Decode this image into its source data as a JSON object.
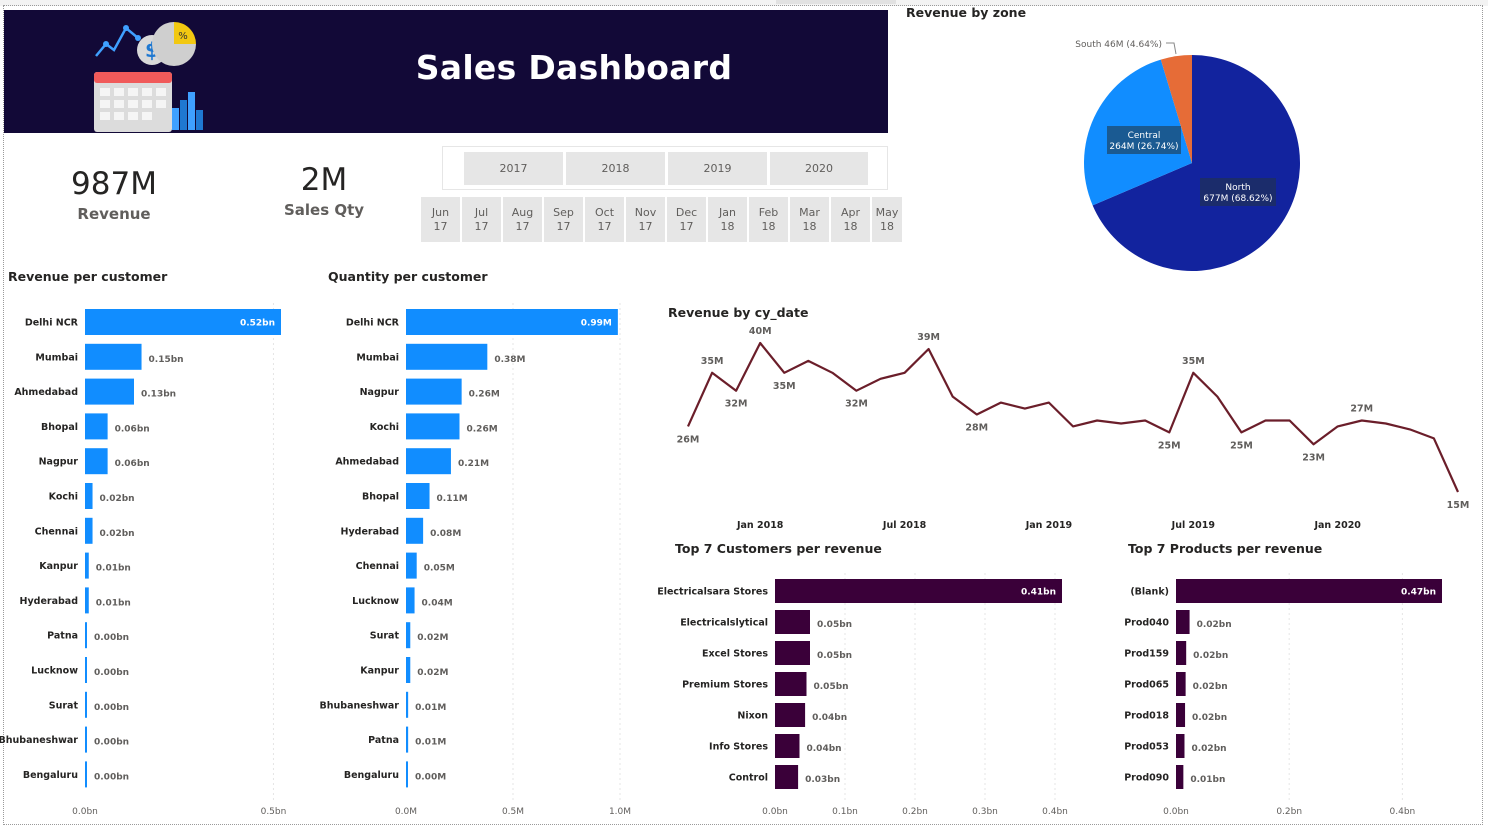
{
  "header": {
    "title": "Sales Dashboard"
  },
  "kpis": [
    {
      "value": "987M",
      "label": "Revenue"
    },
    {
      "value": "2M",
      "label": "Sales Qty"
    }
  ],
  "slicer": {
    "years": [
      "2017",
      "2018",
      "2019",
      "2020"
    ],
    "months": [
      {
        "m": "Jun",
        "y": "17"
      },
      {
        "m": "Jul",
        "y": "17"
      },
      {
        "m": "Aug",
        "y": "17"
      },
      {
        "m": "Sep",
        "y": "17"
      },
      {
        "m": "Oct",
        "y": "17"
      },
      {
        "m": "Nov",
        "y": "17"
      },
      {
        "m": "Dec",
        "y": "17"
      },
      {
        "m": "Jan",
        "y": "18"
      },
      {
        "m": "Feb",
        "y": "18"
      },
      {
        "m": "Mar",
        "y": "18"
      },
      {
        "m": "Apr",
        "y": "18"
      },
      {
        "m": "May",
        "y": "18"
      }
    ]
  },
  "colors": {
    "banner": "#120937",
    "bar_blue": "#118dff",
    "bar_purple": "#3a0039",
    "line": "#6b1e2a",
    "pie_north": "#12239e",
    "pie_central": "#118dff",
    "pie_south": "#e66c37"
  },
  "chart_data": [
    {
      "id": "revenue_per_customer",
      "type": "bar",
      "title": "Revenue per customer",
      "categories": [
        "Delhi NCR",
        "Mumbai",
        "Ahmedabad",
        "Bhopal",
        "Nagpur",
        "Kochi",
        "Chennai",
        "Kanpur",
        "Hyderabad",
        "Patna",
        "Lucknow",
        "Surat",
        "Bhubaneshwar",
        "Bengaluru"
      ],
      "values": [
        0.52,
        0.15,
        0.13,
        0.06,
        0.06,
        0.02,
        0.02,
        0.01,
        0.01,
        0.004,
        0.003,
        0.002,
        0.001,
        0.001
      ],
      "labels": [
        "0.52bn",
        "0.15bn",
        "0.13bn",
        "0.06bn",
        "0.06bn",
        "0.02bn",
        "0.02bn",
        "0.01bn",
        "0.01bn",
        "0.00bn",
        "0.00bn",
        "0.00bn",
        "0.00bn",
        "0.00bn"
      ],
      "xlim": [
        0,
        0.52
      ],
      "ticks": [
        0,
        0.5
      ],
      "tick_labels": [
        "0.0bn",
        "0.5bn"
      ]
    },
    {
      "id": "quantity_per_customer",
      "type": "bar",
      "title": "Quantity per customer",
      "categories": [
        "Delhi NCR",
        "Mumbai",
        "Nagpur",
        "Kochi",
        "Ahmedabad",
        "Bhopal",
        "Hyderabad",
        "Chennai",
        "Lucknow",
        "Surat",
        "Kanpur",
        "Bhubaneshwar",
        "Patna",
        "Bengaluru"
      ],
      "values": [
        0.99,
        0.38,
        0.26,
        0.25,
        0.21,
        0.11,
        0.08,
        0.05,
        0.04,
        0.02,
        0.02,
        0.01,
        0.01,
        0.003
      ],
      "labels": [
        "0.99M",
        "0.38M",
        "0.26M",
        "0.26M",
        "0.21M",
        "0.11M",
        "0.08M",
        "0.05M",
        "0.04M",
        "0.02M",
        "0.02M",
        "0.01M",
        "0.01M",
        "0.00M"
      ],
      "xlim": [
        0,
        1.0
      ],
      "ticks": [
        0,
        0.5,
        1.0
      ],
      "tick_labels": [
        "0.0M",
        "0.5M",
        "1.0M"
      ]
    },
    {
      "id": "revenue_by_zone",
      "type": "pie",
      "title": "Revenue by zone",
      "slices": [
        {
          "name": "North",
          "value": 677,
          "label_line1": "North",
          "label_line2": "677M (68.62%)"
        },
        {
          "name": "Central",
          "value": 264,
          "label_line1": "Central",
          "label_line2": "264M (26.74%)"
        },
        {
          "name": "South",
          "value": 46,
          "label_line1": "South 46M (4.64%)"
        }
      ]
    },
    {
      "id": "revenue_by_cy_date",
      "type": "line",
      "title": "Revenue by cy_date",
      "x": [
        "2017-10",
        "2017-11",
        "2017-12",
        "2018-01",
        "2018-02",
        "2018-03",
        "2018-04",
        "2018-05",
        "2018-06",
        "2018-07",
        "2018-08",
        "2018-09",
        "2018-10",
        "2018-11",
        "2018-12",
        "2019-01",
        "2019-02",
        "2019-03",
        "2019-04",
        "2019-05",
        "2019-06",
        "2019-07",
        "2019-08",
        "2019-09",
        "2019-10",
        "2019-11",
        "2019-12",
        "2020-01",
        "2020-02",
        "2020-03",
        "2020-04",
        "2020-05",
        "2020-06"
      ],
      "values": [
        26,
        35,
        32,
        40,
        35,
        37,
        35,
        32,
        34,
        35,
        39,
        31,
        28,
        30,
        29,
        30,
        26,
        27,
        26.5,
        27,
        25,
        35,
        31,
        25,
        27,
        27,
        23,
        26,
        27,
        26.5,
        25.5,
        24,
        15
      ],
      "point_labels": [
        {
          "i": 0,
          "text": "26M"
        },
        {
          "i": 1,
          "text": "35M"
        },
        {
          "i": 2,
          "text": "32M"
        },
        {
          "i": 3,
          "text": "40M"
        },
        {
          "i": 4,
          "text": "35M"
        },
        {
          "i": 7,
          "text": "32M"
        },
        {
          "i": 10,
          "text": "39M"
        },
        {
          "i": 12,
          "text": "28M"
        },
        {
          "i": 20,
          "text": "25M"
        },
        {
          "i": 21,
          "text": "35M"
        },
        {
          "i": 23,
          "text": "25M"
        },
        {
          "i": 26,
          "text": "23M"
        },
        {
          "i": 28,
          "text": "27M"
        },
        {
          "i": 32,
          "text": "15M"
        }
      ],
      "x_ticks": [
        {
          "i": 3,
          "text": "Jan 2018"
        },
        {
          "i": 9,
          "text": "Jul 2018"
        },
        {
          "i": 15,
          "text": "Jan 2019"
        },
        {
          "i": 21,
          "text": "Jul 2019"
        },
        {
          "i": 27,
          "text": "Jan 2020"
        }
      ],
      "ylim": [
        15,
        40
      ]
    },
    {
      "id": "top7_customers",
      "type": "bar",
      "title": "Top 7 Customers per revenue",
      "categories": [
        "Electricalsara Stores",
        "Electricalslytical",
        "Excel Stores",
        "Premium Stores",
        "Nixon",
        "Info Stores",
        "Control"
      ],
      "values": [
        0.41,
        0.05,
        0.05,
        0.045,
        0.043,
        0.035,
        0.033
      ],
      "labels": [
        "0.41bn",
        "0.05bn",
        "0.05bn",
        "0.05bn",
        "0.04bn",
        "0.04bn",
        "0.03bn"
      ],
      "xlim": [
        0,
        0.41
      ],
      "ticks": [
        0,
        0.1,
        0.2,
        0.3,
        0.4
      ],
      "tick_labels": [
        "0.0bn",
        "0.1bn",
        "0.2bn",
        "0.3bn",
        "0.4bn"
      ]
    },
    {
      "id": "top7_products",
      "type": "bar",
      "title": "Top 7 Products per revenue",
      "categories": [
        "(Blank)",
        "Prod040",
        "Prod159",
        "Prod065",
        "Prod018",
        "Prod053",
        "Prod090"
      ],
      "values": [
        0.47,
        0.024,
        0.018,
        0.017,
        0.016,
        0.015,
        0.013
      ],
      "labels": [
        "0.47bn",
        "0.02bn",
        "0.02bn",
        "0.02bn",
        "0.02bn",
        "0.02bn",
        "0.01bn"
      ],
      "xlim": [
        0,
        0.47
      ],
      "ticks": [
        0,
        0.2,
        0.4
      ],
      "tick_labels": [
        "0.0bn",
        "0.2bn",
        "0.4bn"
      ]
    }
  ]
}
